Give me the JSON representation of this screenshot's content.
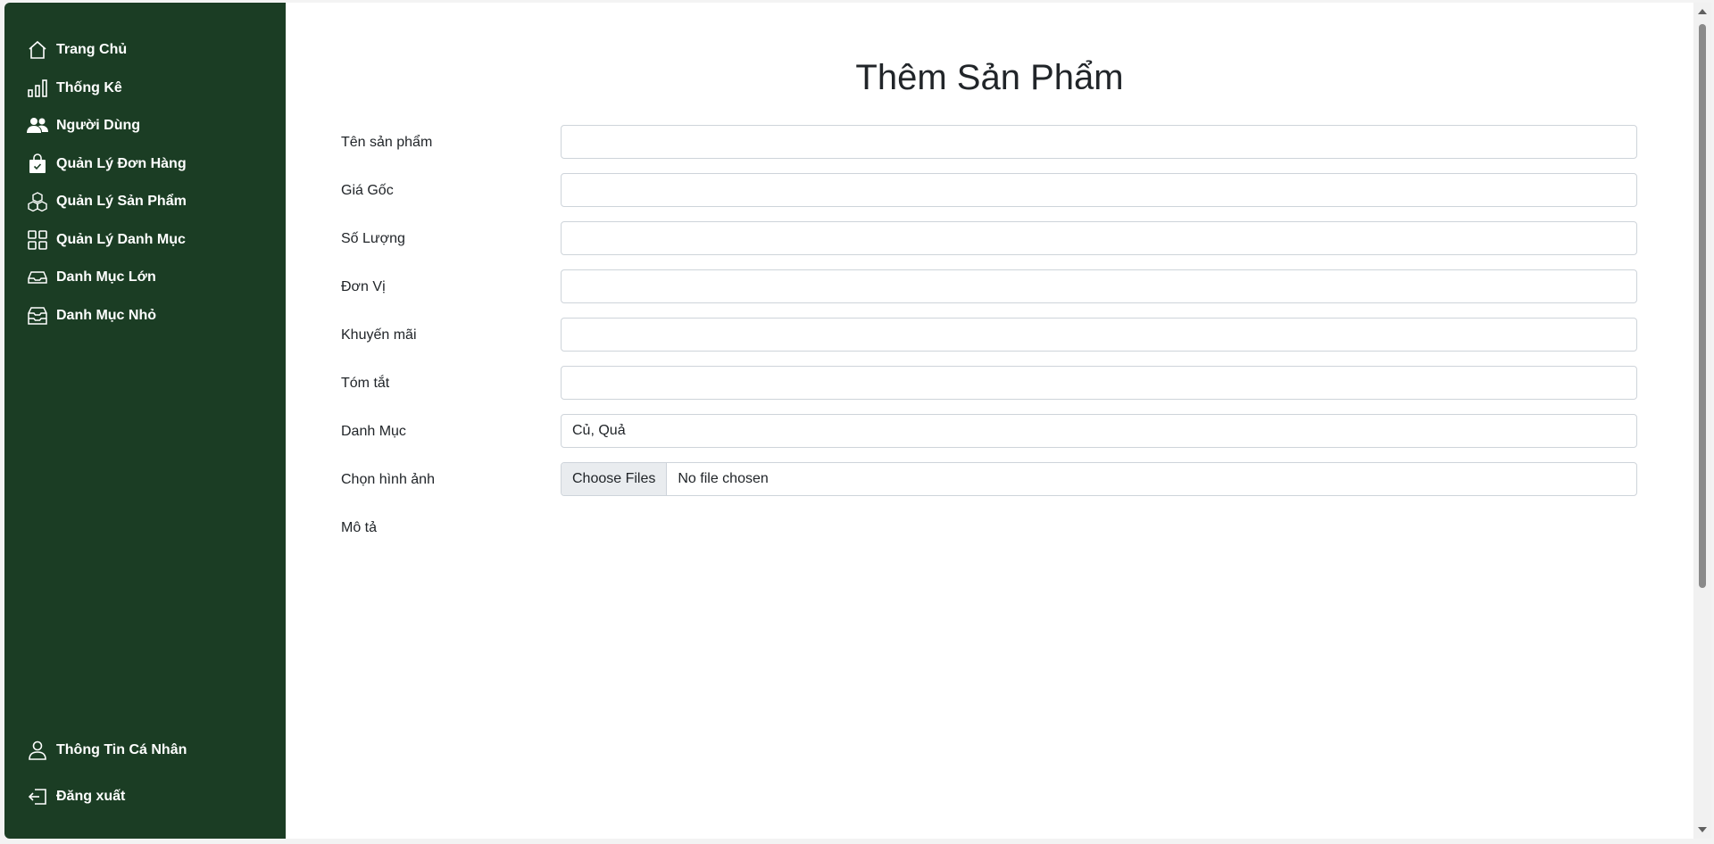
{
  "sidebar": {
    "items": [
      {
        "label": "Trang Chủ",
        "icon": "home-icon"
      },
      {
        "label": "Thống Kê",
        "icon": "bar-chart-icon"
      },
      {
        "label": "Người Dùng",
        "icon": "users-icon"
      },
      {
        "label": "Quản Lý Đơn Hàng",
        "icon": "shopping-bag-icon"
      },
      {
        "label": "Quản Lý Sản Phẩm",
        "icon": "boxes-icon"
      },
      {
        "label": "Quản Lý Danh Mục",
        "icon": "grid-icon"
      },
      {
        "label": "Danh Mục Lớn",
        "icon": "inbox-icon"
      },
      {
        "label": "Danh Mục Nhỏ",
        "icon": "archive-icon"
      }
    ],
    "bottom_items": [
      {
        "label": "Thông Tin Cá Nhân",
        "icon": "person-icon"
      },
      {
        "label": "Đăng xuất",
        "icon": "logout-icon"
      }
    ],
    "bg_color": "#1b3d24"
  },
  "main": {
    "title": "Thêm Sản Phẩm",
    "fields": [
      {
        "label": "Tên sản phẩm",
        "value": ""
      },
      {
        "label": "Giá Gốc",
        "value": ""
      },
      {
        "label": "Số Lượng",
        "value": ""
      },
      {
        "label": "Đơn Vị",
        "value": ""
      },
      {
        "label": "Khuyến mãi",
        "value": ""
      },
      {
        "label": "Tóm tắt",
        "value": ""
      },
      {
        "label": "Danh Mục",
        "value": "Củ, Quả"
      }
    ],
    "file_field": {
      "label": "Chọn hình ảnh",
      "button_label": "Choose Files",
      "status": "No file chosen"
    },
    "description_label": "Mô tả"
  }
}
